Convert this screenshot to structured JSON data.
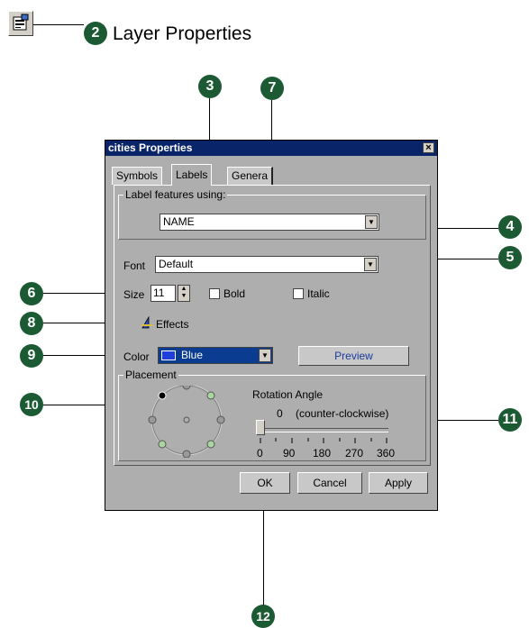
{
  "header": {
    "step_number": "2",
    "title": "Layer Properties",
    "icon": "layer-properties-icon"
  },
  "dialog": {
    "title": "cities Properties",
    "close_glyph": "×",
    "tabs": [
      {
        "label": "Symbols"
      },
      {
        "label": "Labels"
      },
      {
        "label": "Genera"
      }
    ],
    "label_features": {
      "group_label": "Label features using:",
      "value": "NAME"
    },
    "font": {
      "label": "Font",
      "value": "Default"
    },
    "size": {
      "label": "Size",
      "value": "11"
    },
    "bold_label": "Bold",
    "italic_label": "Italic",
    "effects_label": "Effects",
    "color": {
      "label": "Color",
      "value": "Blue",
      "swatch": "#1f3fd8"
    },
    "preview_label": "Preview",
    "placement": {
      "group_label": "Placement",
      "rotation_label": "Rotation Angle",
      "rotation_value": "0",
      "rotation_direction": "(counter-clockwise)",
      "ticks": [
        "0",
        "90",
        "180",
        "270",
        "360"
      ]
    },
    "buttons": {
      "ok": "OK",
      "cancel": "Cancel",
      "apply": "Apply"
    }
  },
  "callouts": {
    "c3": "3",
    "c7": "7",
    "c4": "4",
    "c5": "5",
    "c6": "6",
    "c8": "8",
    "c9": "9",
    "c10": "10",
    "c11": "11",
    "c12": "12"
  },
  "colors": {
    "callout": "#1c5a34",
    "titlebar": "#0a246a",
    "dialog_bg": "#aeaeae"
  }
}
